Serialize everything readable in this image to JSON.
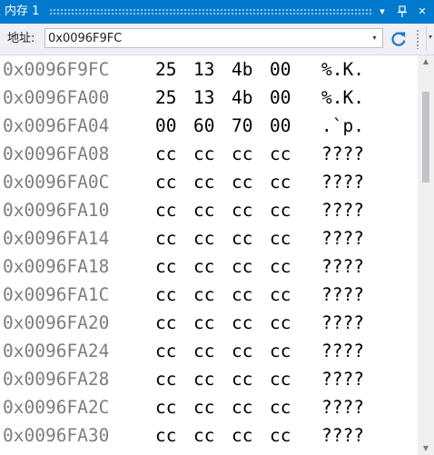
{
  "window": {
    "title": "内存 1",
    "dropdown_glyph": "▾",
    "pin_glyph": "📌",
    "close_glyph": "✕"
  },
  "toolbar": {
    "address_label": "地址:",
    "address_value": "0x0096F9FC",
    "dropdown_glyph": "▾",
    "overflow_glyph": "▾",
    "refresh_icon": "refresh-icon"
  },
  "memory": {
    "rows": [
      {
        "address": "0x0096F9FC",
        "bytes": [
          "25",
          "13",
          "4b",
          "00"
        ],
        "ascii": "%.K."
      },
      {
        "address": "0x0096FA00",
        "bytes": [
          "25",
          "13",
          "4b",
          "00"
        ],
        "ascii": "%.K."
      },
      {
        "address": "0x0096FA04",
        "bytes": [
          "00",
          "60",
          "70",
          "00"
        ],
        "ascii": ".`p."
      },
      {
        "address": "0x0096FA08",
        "bytes": [
          "cc",
          "cc",
          "cc",
          "cc"
        ],
        "ascii": "????"
      },
      {
        "address": "0x0096FA0C",
        "bytes": [
          "cc",
          "cc",
          "cc",
          "cc"
        ],
        "ascii": "????"
      },
      {
        "address": "0x0096FA10",
        "bytes": [
          "cc",
          "cc",
          "cc",
          "cc"
        ],
        "ascii": "????"
      },
      {
        "address": "0x0096FA14",
        "bytes": [
          "cc",
          "cc",
          "cc",
          "cc"
        ],
        "ascii": "????"
      },
      {
        "address": "0x0096FA18",
        "bytes": [
          "cc",
          "cc",
          "cc",
          "cc"
        ],
        "ascii": "????"
      },
      {
        "address": "0x0096FA1C",
        "bytes": [
          "cc",
          "cc",
          "cc",
          "cc"
        ],
        "ascii": "????"
      },
      {
        "address": "0x0096FA20",
        "bytes": [
          "cc",
          "cc",
          "cc",
          "cc"
        ],
        "ascii": "????"
      },
      {
        "address": "0x0096FA24",
        "bytes": [
          "cc",
          "cc",
          "cc",
          "cc"
        ],
        "ascii": "????"
      },
      {
        "address": "0x0096FA28",
        "bytes": [
          "cc",
          "cc",
          "cc",
          "cc"
        ],
        "ascii": "????"
      },
      {
        "address": "0x0096FA2C",
        "bytes": [
          "cc",
          "cc",
          "cc",
          "cc"
        ],
        "ascii": "????"
      },
      {
        "address": "0x0096FA30",
        "bytes": [
          "cc",
          "cc",
          "cc",
          "cc"
        ],
        "ascii": "????"
      }
    ]
  },
  "colors": {
    "title_bar": "#007acc",
    "address_text": "#7d7d7d",
    "value_text": "#000000",
    "refresh_icon": "#1c77c3"
  }
}
